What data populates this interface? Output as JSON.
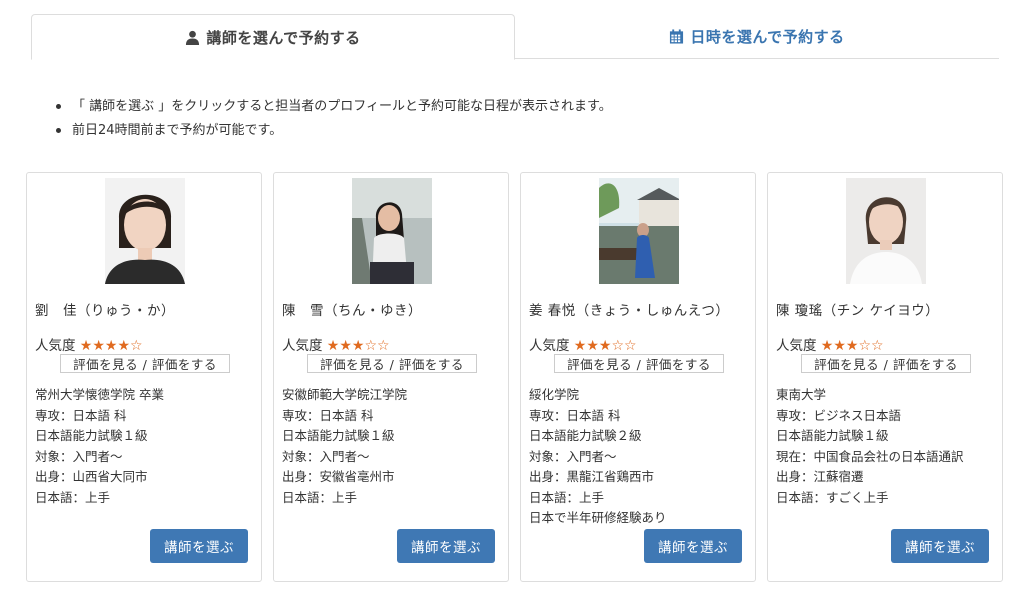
{
  "tabs": [
    {
      "label": "講師を選んで予約する",
      "icon": "user-icon",
      "active": true
    },
    {
      "label": "日時を選んで予約する",
      "icon": "calendar-icon",
      "active": false
    }
  ],
  "notes": [
    "「 講師を選ぶ 」をクリックすると担当者のプロフィールと予約可能な日程が表示されます。",
    "前日24時間前まで予約が可能です。"
  ],
  "colors": {
    "accent": "#3f78b4",
    "tab_link": "#3a75b0",
    "star": "#e06a1f"
  },
  "teachers": [
    {
      "name": "劉　佳（りゅう・か）",
      "popularity_label": "人気度",
      "stars": "★★★★☆",
      "rating": 4,
      "review_button": "評価を見る / 評価をする",
      "info": [
        "常州大学懐徳学院 卒業",
        "専攻：日本語 科",
        "日本語能力試験１級",
        "対象：入門者〜",
        "出身：山西省大同市",
        "日本語：上手"
      ],
      "choose_button": "講師を選ぶ"
    },
    {
      "name": "陳　雪（ちん・ゆき）",
      "popularity_label": "人気度",
      "stars": "★★★☆☆",
      "rating": 3,
      "review_button": "評価を見る / 評価をする",
      "info": [
        "安徽師範大学皖江学院",
        "専攻：日本語 科",
        "日本語能力試験１級",
        "対象：入門者〜",
        "出身：安徽省亳州市",
        "日本語：上手"
      ],
      "choose_button": "講師を選ぶ"
    },
    {
      "name": "姜 春悦（きょう・しゅんえつ）",
      "popularity_label": "人気度",
      "stars": "★★★☆☆",
      "rating": 3,
      "review_button": "評価を見る / 評価をする",
      "info": [
        "綏化学院",
        "専攻：日本語 科",
        "日本語能力試験２級",
        "対象：入門者〜",
        "出身：黒龍江省鶏西市",
        "日本語：上手",
        "日本で半年研修経験あり"
      ],
      "choose_button": "講師を選ぶ"
    },
    {
      "name": "陳 瓊瑤（チン ケイヨウ）",
      "popularity_label": "人気度",
      "stars": "★★★☆☆",
      "rating": 3,
      "review_button": "評価を見る / 評価をする",
      "info": [
        "東南大学",
        "専攻：ビジネス日本語",
        "日本語能力試験１級",
        "現在：中国食品会社の日本語通訳",
        "出身：江蘇宿遷",
        "日本語：すごく上手"
      ],
      "choose_button": "講師を選ぶ"
    }
  ]
}
